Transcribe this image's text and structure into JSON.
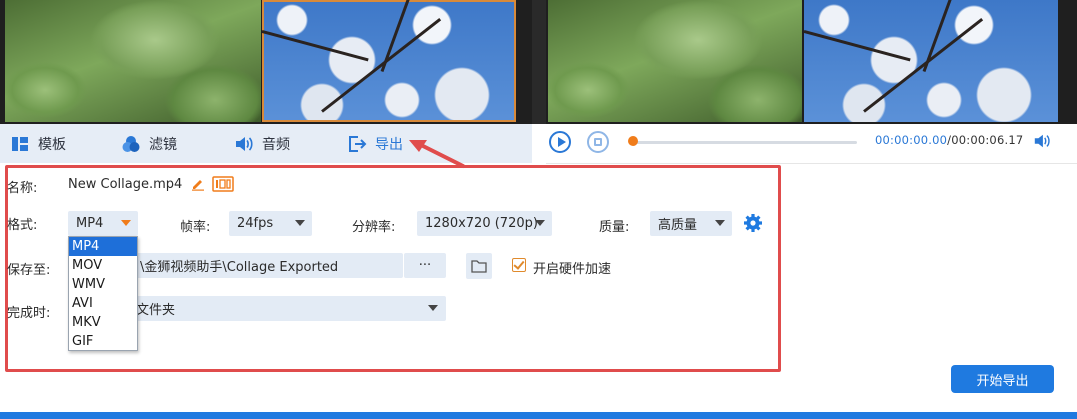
{
  "toolbar": {
    "tabs": [
      {
        "label": "模板",
        "icon": "layout-icon"
      },
      {
        "label": "滤镜",
        "icon": "filter-icon"
      },
      {
        "label": "音频",
        "icon": "audio-icon"
      },
      {
        "label": "导出",
        "icon": "export-icon",
        "active": true
      }
    ]
  },
  "player": {
    "time_current": "00:00:00.00",
    "time_total": "/00:00:06.17",
    "progress": 0.0
  },
  "export": {
    "name_label": "名称:",
    "name_value": "New Collage.mp4",
    "format_label": "格式:",
    "format_value": "MP4",
    "format_options": [
      "MP4",
      "MOV",
      "WMV",
      "AVI",
      "MKV",
      "GIF"
    ],
    "fps_label": "帧率:",
    "fps_value": "24fps",
    "resolution_label": "分辨率:",
    "resolution_value": "1280x720 (720p)",
    "quality_label": "质量:",
    "quality_value": "高质量",
    "save_label": "保存至:",
    "save_path": "\\金狮视频助手\\Collage Exported",
    "browse_label": "···",
    "hw_accel_label": "开启硬件加速",
    "hw_accel_checked": true,
    "on_complete_label": "完成时:",
    "on_complete_value": "文件夹"
  },
  "start_export_label": "开始导出",
  "colors": {
    "accent": "#1f7ae0",
    "highlight_border": "#e04c4c",
    "orange": "#f07c1a"
  }
}
